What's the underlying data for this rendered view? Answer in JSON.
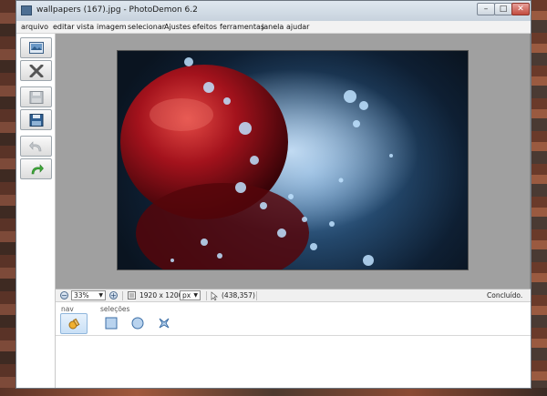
{
  "window": {
    "title": "wallpapers (167).jpg  -  PhotoDemon 6.2",
    "minimize_glyph": "–",
    "maximize_glyph": "□",
    "close_glyph": "✕"
  },
  "menu": {
    "items": [
      "arquivo",
      "editar",
      "vista",
      "imagem",
      "selecionar",
      "Ajustes",
      "efeitos",
      "ferramentas",
      "janela",
      "ajudar"
    ]
  },
  "left_toolbar": {
    "buttons": [
      "open-image",
      "close-image",
      "save",
      "save-as",
      "undo",
      "redo"
    ]
  },
  "image": {
    "description_icon": "photo-canvas"
  },
  "status": {
    "zoom_value": "33%",
    "image_size": "1920 x 1200",
    "unit": "px",
    "cursor_position": "(438,357)",
    "status_text": "Concluído."
  },
  "tools_panel": {
    "nav_label": "nav",
    "selections_label": "seleções"
  },
  "colors": {
    "accent": "#4d6f93",
    "apple_red": "#a3121c",
    "water_blue": "#5a8fc2"
  }
}
